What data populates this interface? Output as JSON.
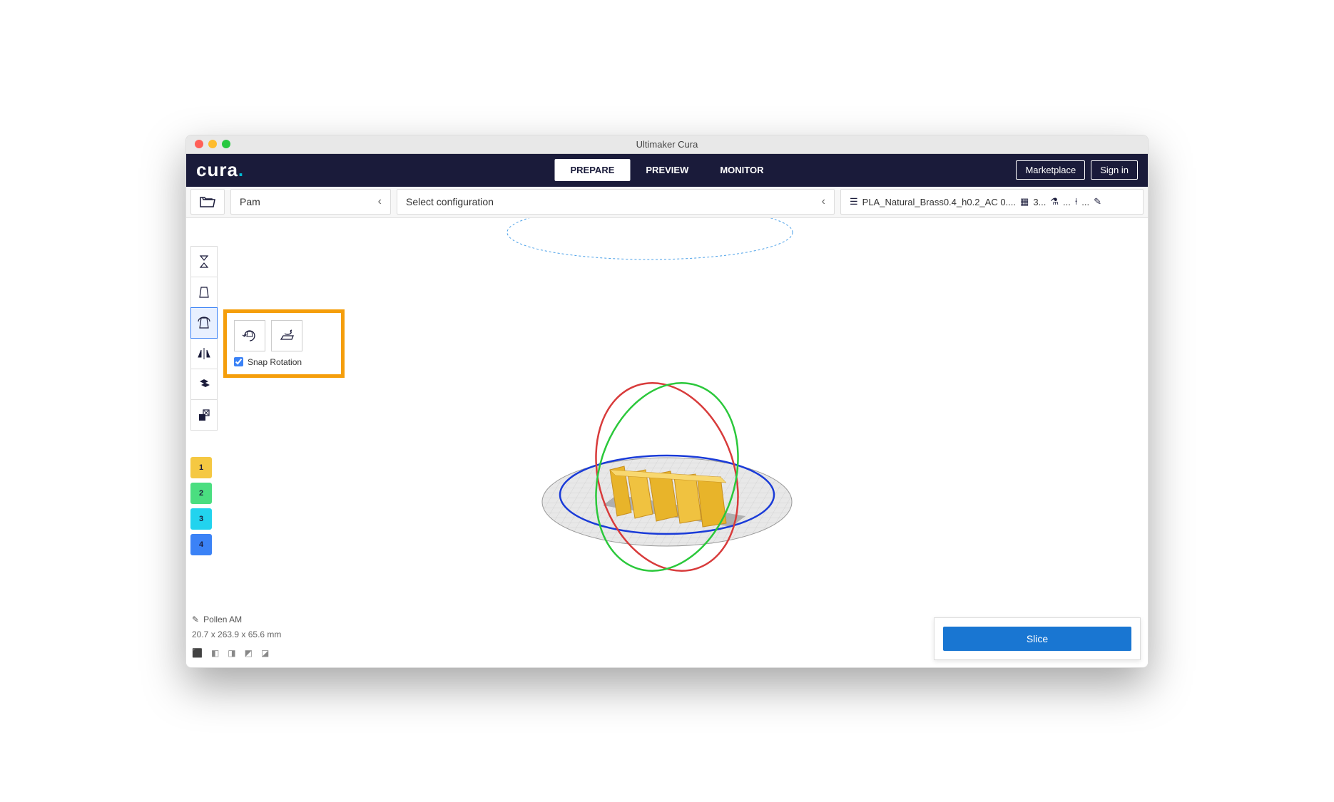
{
  "window": {
    "title": "Ultimaker Cura"
  },
  "logo": "cura",
  "tabs": {
    "prepare": "PREPARE",
    "preview": "PREVIEW",
    "monitor": "MONITOR"
  },
  "topbar": {
    "marketplace": "Marketplace",
    "signin": "Sign in"
  },
  "secondbar": {
    "printer": "Pam",
    "config": "Select configuration",
    "profile": "PLA_Natural_Brass0.4_h0.2_AC 0....",
    "infill": "3..."
  },
  "rotate_panel": {
    "snap_label": "Snap Rotation",
    "snap_checked": true
  },
  "extruders": [
    "1",
    "2",
    "3",
    "4"
  ],
  "object": {
    "name": "Pollen AM",
    "dimensions": "20.7 x 263.9 x 65.6 mm"
  },
  "slice": {
    "label": "Slice"
  }
}
